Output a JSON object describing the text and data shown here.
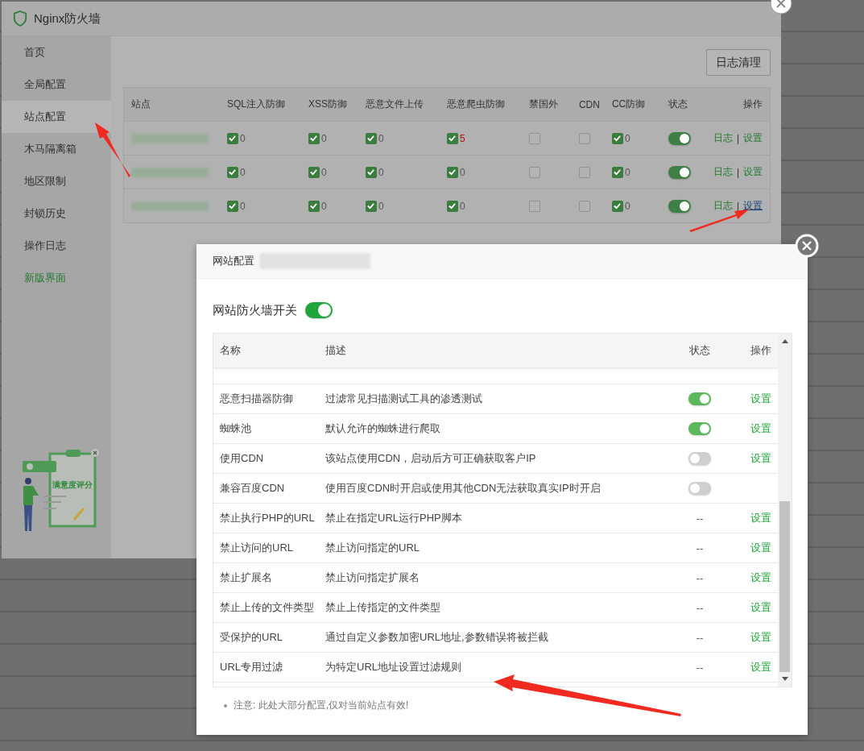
{
  "app": {
    "title": "Nginx防火墙"
  },
  "sidebar": {
    "items": [
      {
        "label": "首页",
        "selected": false,
        "kind": "nav"
      },
      {
        "label": "全局配置",
        "selected": false,
        "kind": "nav"
      },
      {
        "label": "站点配置",
        "selected": true,
        "kind": "nav"
      },
      {
        "label": "木马隔离箱",
        "selected": false,
        "kind": "nav"
      },
      {
        "label": "地区限制",
        "selected": false,
        "kind": "nav"
      },
      {
        "label": "封锁历史",
        "selected": false,
        "kind": "nav"
      },
      {
        "label": "操作日志",
        "selected": false,
        "kind": "nav"
      },
      {
        "label": "新版界面",
        "selected": false,
        "kind": "link"
      }
    ]
  },
  "rating_widget": {
    "label": "满意度评分"
  },
  "toolbar": {
    "clear_logs_button": "日志清理"
  },
  "sites_table": {
    "columns": [
      "站点",
      "SQL注入防御",
      "XSS防御",
      "恶意文件上传",
      "恶意爬虫防御",
      "禁国外",
      "CDN",
      "CC防御",
      "状态",
      "操作"
    ],
    "rows": [
      {
        "protections": [
          {
            "checked": true,
            "count": "0",
            "color": "#555555"
          },
          {
            "checked": true,
            "count": "0",
            "color": "#555555"
          },
          {
            "checked": true,
            "count": "0",
            "color": "#555555"
          },
          {
            "checked": true,
            "count": "5",
            "color": "#b01010"
          },
          {
            "checked": false
          },
          {
            "checked": false
          },
          {
            "checked": true,
            "count": "0",
            "color": "#555555"
          }
        ],
        "on": true,
        "actions": [
          {
            "label": "日志",
            "hovered": false
          },
          {
            "label": "设置",
            "hovered": false
          }
        ],
        "separator": "|"
      },
      {
        "protections": [
          {
            "checked": true,
            "count": "0",
            "color": "#555555"
          },
          {
            "checked": true,
            "count": "0",
            "color": "#555555"
          },
          {
            "checked": true,
            "count": "0",
            "color": "#555555"
          },
          {
            "checked": true,
            "count": "0",
            "color": "#555555"
          },
          {
            "checked": false
          },
          {
            "checked": false
          },
          {
            "checked": true,
            "count": "0",
            "color": "#555555"
          }
        ],
        "on": true,
        "actions": [
          {
            "label": "日志",
            "hovered": false
          },
          {
            "label": "设置",
            "hovered": false
          }
        ],
        "separator": "|"
      },
      {
        "protections": [
          {
            "checked": true,
            "count": "0",
            "color": "#555555"
          },
          {
            "checked": true,
            "count": "0",
            "color": "#555555"
          },
          {
            "checked": true,
            "count": "0",
            "color": "#555555"
          },
          {
            "checked": true,
            "count": "0",
            "color": "#555555"
          },
          {
            "checked": false
          },
          {
            "checked": false
          },
          {
            "checked": true,
            "count": "0",
            "color": "#555555"
          }
        ],
        "on": true,
        "actions": [
          {
            "label": "日志",
            "hovered": false
          },
          {
            "label": "设置",
            "hovered": true
          }
        ],
        "separator": "|"
      }
    ]
  },
  "modal": {
    "title": "网站配置",
    "master_switch": {
      "label": "网站防火墙开关",
      "on": true
    },
    "columns": [
      "名称",
      "描述",
      "状态",
      "操作"
    ],
    "rows": [
      {
        "name": "恶意扫描器防御",
        "description": "过滤常见扫描测试工具的渗透测试",
        "kind": "toggle",
        "on": true,
        "action": "设置"
      },
      {
        "name": "蜘蛛池",
        "description": "默认允许的蜘蛛进行爬取",
        "kind": "toggle",
        "on": true,
        "action": "设置"
      },
      {
        "name": "使用CDN",
        "description": "该站点使用CDN，启动后方可正确获取客户IP",
        "kind": "toggle",
        "on": false,
        "action": "设置"
      },
      {
        "name": "兼容百度CDN",
        "description": "使用百度CDN时开启或使用其他CDN无法获取真实IP时开启",
        "kind": "toggle",
        "on": false
      },
      {
        "name": "禁止执行PHP的URL",
        "description": "禁止在指定URL运行PHP脚本",
        "kind": "text",
        "status": "--",
        "action": "设置"
      },
      {
        "name": "禁止访问的URL",
        "description": "禁止访问指定的URL",
        "kind": "text",
        "status": "--",
        "action": "设置"
      },
      {
        "name": "禁止扩展名",
        "description": "禁止访问指定扩展名",
        "kind": "text",
        "status": "--",
        "action": "设置"
      },
      {
        "name": "禁止上传的文件类型",
        "description": "禁止上传指定的文件类型",
        "kind": "text",
        "status": "--",
        "action": "设置"
      },
      {
        "name": "受保护的URL",
        "description": "通过自定义参数加密URL地址,参数错误将被拦截",
        "kind": "text",
        "status": "--",
        "action": "设置"
      },
      {
        "name": "URL专用过滤",
        "description": "为特定URL地址设置过滤规则",
        "kind": "text",
        "status": "--",
        "action": "设置"
      }
    ],
    "note": "注意: 此处大部分配置,仅对当前站点有效!"
  }
}
